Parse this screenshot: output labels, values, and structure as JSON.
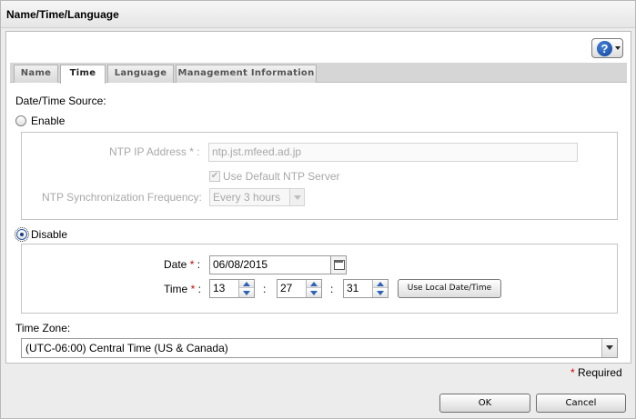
{
  "window": {
    "title": "Name/Time/Language"
  },
  "toolbar": {
    "help_icon_glyph": "?"
  },
  "tabs": [
    {
      "label": "Name",
      "active": false
    },
    {
      "label": "Time",
      "active": true
    },
    {
      "label": "Language",
      "active": false
    },
    {
      "label": "Management Information",
      "active": false
    }
  ],
  "source": {
    "heading": "Date/Time Source:",
    "enable_label": "Enable",
    "disable_label": "Disable",
    "selected": "Disable"
  },
  "ntp": {
    "ip_label": "NTP IP Address",
    "ip_value": "ntp.jst.mfeed.ad.jp",
    "use_default_label": "Use Default NTP Server",
    "use_default_checked": true,
    "frequency_label": "NTP Synchronization Frequency:",
    "frequency_value": "Every 3 hours"
  },
  "manual": {
    "date_label": "Date",
    "date_value": "06/08/2015",
    "time_label": "Time",
    "hour": "13",
    "minute": "27",
    "second": "31",
    "separator": ":",
    "use_local_label": "Use Local Date/Time"
  },
  "timezone": {
    "label": "Time Zone:",
    "value": "(UTC-06:00) Central Time (US & Canada)"
  },
  "required": {
    "asterisk": "*",
    "label": "Required",
    "label_suffix": " :"
  },
  "footer": {
    "ok_label": "OK",
    "cancel_label": "Cancel"
  },
  "colors": {
    "required": "#d40000",
    "accent": "#2c62b8"
  }
}
